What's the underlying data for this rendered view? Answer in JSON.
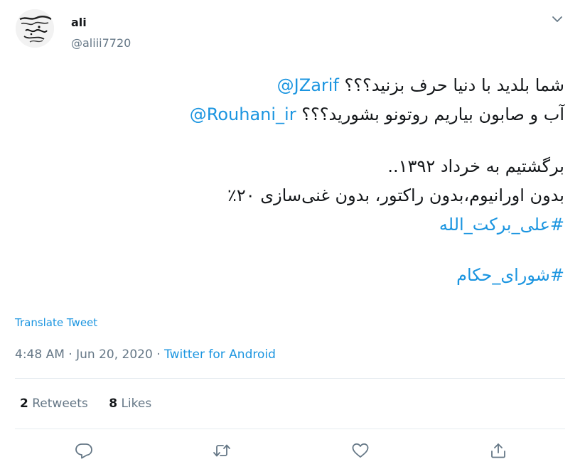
{
  "author": {
    "name": "ali",
    "handle": "@aliii7720",
    "avatar_icon": "calligraphy-avatar"
  },
  "tweet": {
    "line1": {
      "text": "شما بلدید با دنیا حرف بزنید؟؟؟ ",
      "mention": "@JZarif"
    },
    "line2": {
      "text": "آب و صابون بیاریم روتونو بشورید؟؟؟ ",
      "mention": "@Rouhani_ir"
    },
    "line3": "برگشتیم به خرداد ۱۳۹۲..",
    "line4": "بدون اورانیوم،بدون راکتور، بدون غنی‌سازی ۲۰٪",
    "hashtag1": "#علی_برکت_الله",
    "hashtag2": "#شورای_حکام"
  },
  "translate_label": "Translate Tweet",
  "meta": {
    "time": "4:48 AM",
    "separator": "·",
    "date": "Jun 20, 2020",
    "source": "Twitter for Android"
  },
  "stats": {
    "retweets_count": "2",
    "retweets_label": "Retweets",
    "likes_count": "8",
    "likes_label": "Likes"
  },
  "actions": {
    "reply_icon": "reply-icon",
    "retweet_icon": "retweet-icon",
    "like_icon": "heart-icon",
    "share_icon": "share-icon"
  },
  "colors": {
    "link": "#1b95e0",
    "secondary_text": "#657786",
    "divider": "#e6ecf0",
    "icon": "#657786"
  }
}
